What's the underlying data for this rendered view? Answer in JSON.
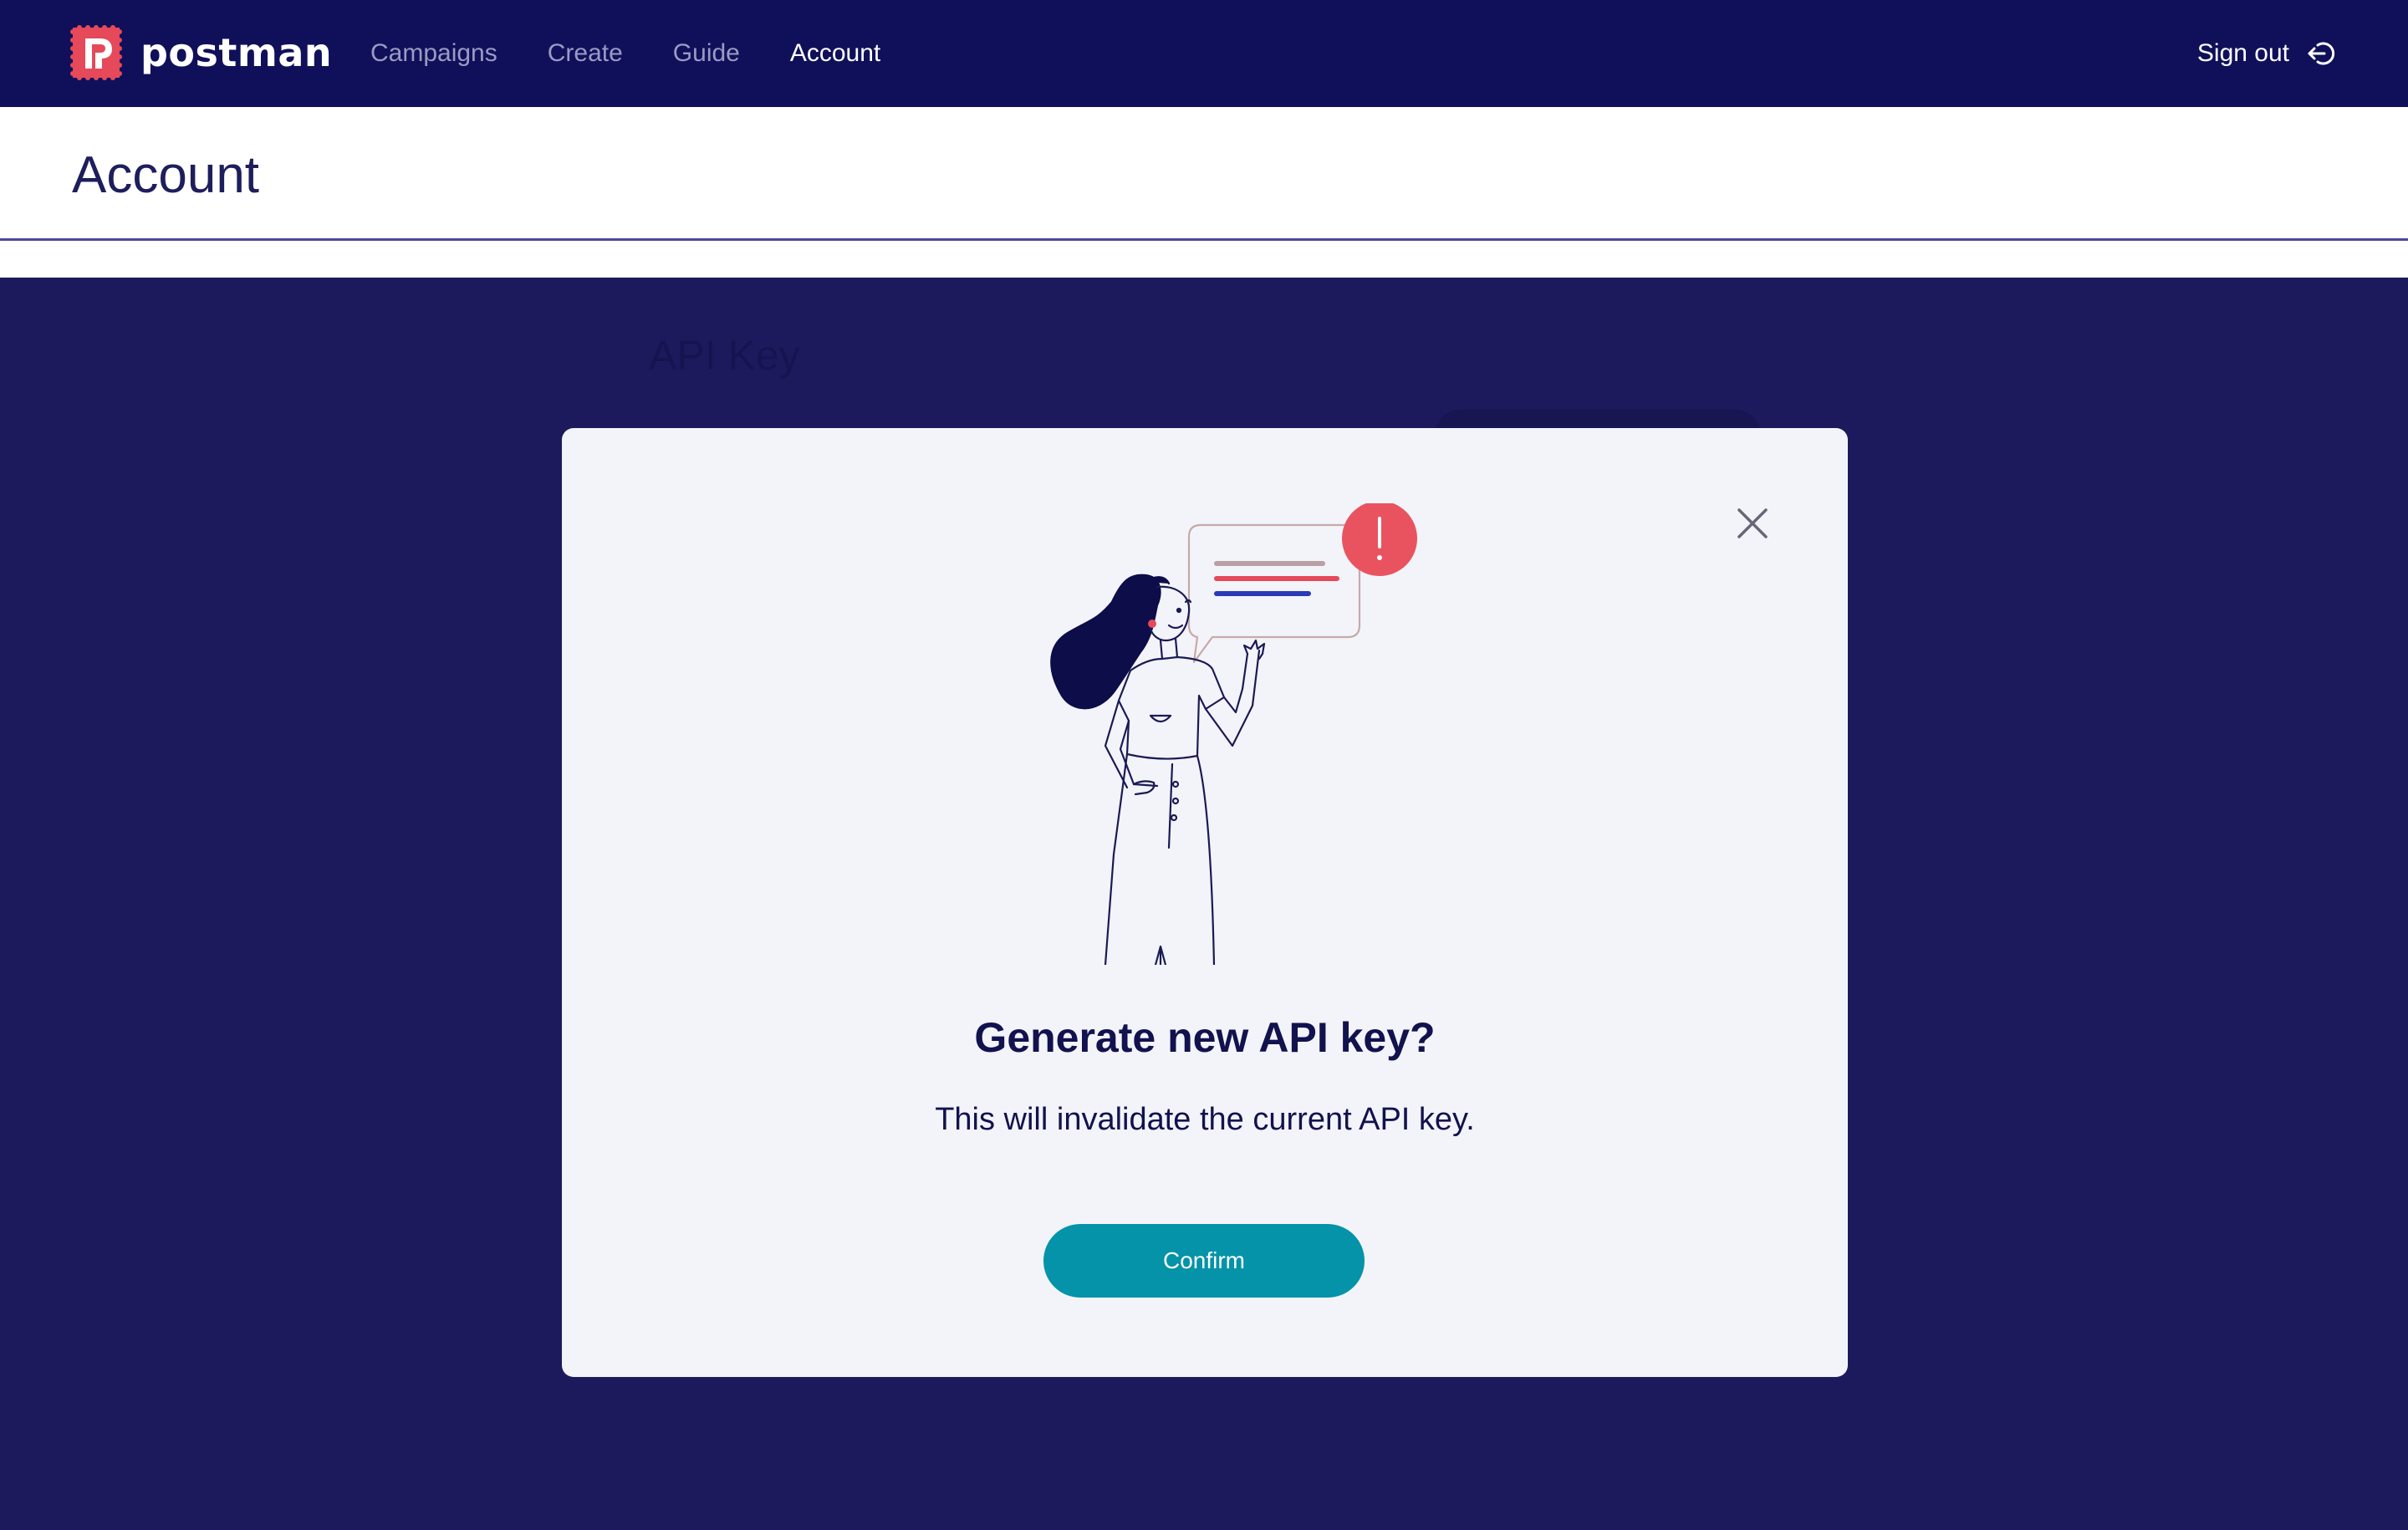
{
  "app": {
    "logo_text": "postman"
  },
  "nav": {
    "items": [
      {
        "label": "Campaigns",
        "active": false
      },
      {
        "label": "Create",
        "active": false
      },
      {
        "label": "Guide",
        "active": false
      },
      {
        "label": "Account",
        "active": true
      }
    ],
    "sign_out_label": "Sign out",
    "sign_out_icon": "sign-out-icon"
  },
  "page": {
    "title": "Account"
  },
  "background": {
    "section_title": "API Key"
  },
  "modal": {
    "title": "Generate new API key?",
    "message": "This will invalidate the current API key.",
    "confirm_label": "Confirm",
    "close_icon": "close-icon",
    "illustration": "woman-with-alert-speech-bubble-illustration",
    "alert_mark": "!"
  },
  "colors": {
    "nav_bg": "#10105a",
    "overlay_bg": "#1c1a5c",
    "modal_bg": "#f3f4f9",
    "primary_button": "#0493a8",
    "logo_red": "#e5495a",
    "text_dark": "#12124e"
  }
}
